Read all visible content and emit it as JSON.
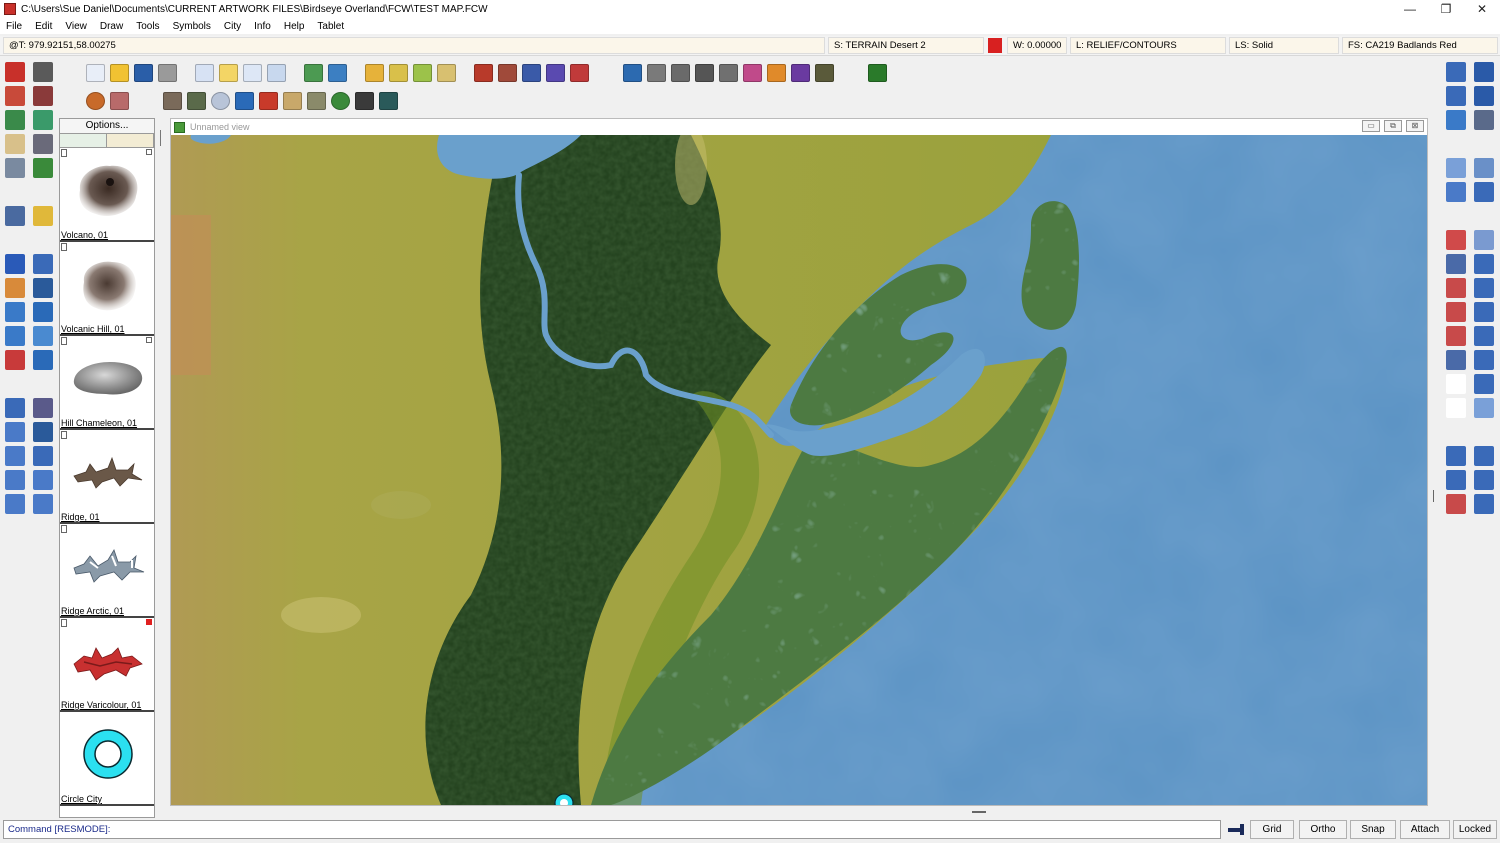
{
  "window": {
    "title": "C:\\Users\\Sue Daniel\\Documents\\CURRENT ARTWORK FILES\\Birdseye Overland\\FCW\\TEST MAP.FCW",
    "minimize": "—",
    "maximize": "❐",
    "close": "✕"
  },
  "menu": [
    "File",
    "Edit",
    "View",
    "Draw",
    "Tools",
    "Symbols",
    "City",
    "Info",
    "Help",
    "Tablet"
  ],
  "status": {
    "coords": "@T: 979.92151,58.00275",
    "sheet": "S: TERRAIN Desert 2",
    "color_swatch": "#d82020",
    "width": "W: 0.00000",
    "layer": "L: RELIEF/CONTOURS",
    "line_style": "LS: Solid",
    "fill_style": "FS: CA219 Badlands Red"
  },
  "catalog": {
    "options_label": "Options...",
    "symbols": [
      {
        "label": "Volcano, 01",
        "icon": "volcano-icon"
      },
      {
        "label": "Volcanic Hill, 01",
        "icon": "volcanic-hill-icon"
      },
      {
        "label": "Hill Chameleon, 01",
        "icon": "hill-icon"
      },
      {
        "label": "Ridge, 01",
        "icon": "ridge-icon"
      },
      {
        "label": "Ridge Arctic, 01",
        "icon": "ridge-arctic-icon"
      },
      {
        "label": "Ridge Varicolour, 01",
        "icon": "ridge-varicolour-icon"
      },
      {
        "label": "Circle City",
        "icon": "circle-city-icon"
      }
    ]
  },
  "map_window": {
    "title": "Unnamed view",
    "btn_min": "▭",
    "btn_restore": "⧉",
    "btn_close": "⊠"
  },
  "command": {
    "text": "Command [RESMODE]:",
    "buttons": [
      "Grid",
      "Ortho",
      "Snap",
      "Attach",
      "Locked"
    ]
  },
  "colors": {
    "water": "#5b93c4",
    "land_yellow": "#a8a63c",
    "forest": "#24431f",
    "swamp": "#4d7a42"
  }
}
